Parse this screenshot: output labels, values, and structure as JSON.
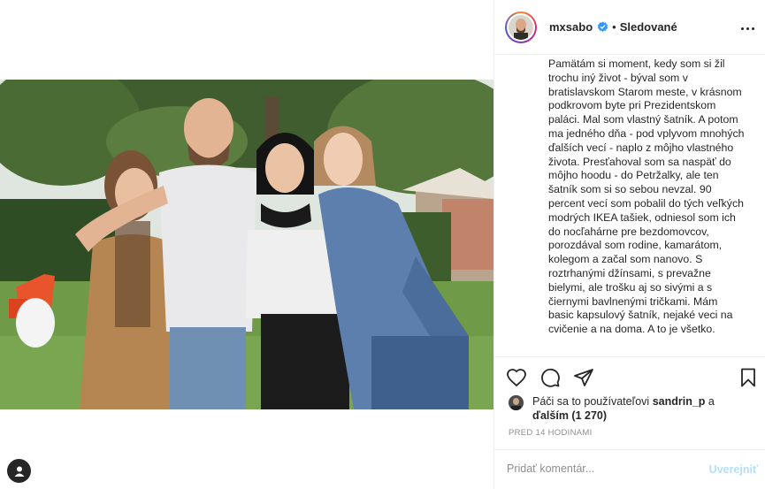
{
  "post": {
    "username": "mxsabo",
    "separator": "•",
    "follow_state": "Sledované",
    "caption": "Pamätám si moment, kedy som si žil trochu iný život - býval som v bratislavskom Starom meste, v krásnom podkrovom byte pri Prezidentskom paláci. Mal som vlastný šatník. A potom ma jedného dňa - pod vplyvom mnohých ďalších vecí - naplo z môjho vlastného života. Presťahoval som sa naspäť do môjho hoodu - do Petržalky, ale ten šatník som si so sebou nevzal. 90 percent vecí som pobalil do tých veľkých modrých IKEA tašiek, odniesol som ich do nocľahárne pre bezdomovcov, porozdával som rodine, kamarátom, kolegom a začal som nanovo. S roztrhanými džínsami, s prevažne bielymi, ale trošku aj so sivými a s čiernymi bavlnenými tričkami. Mám basic kapsulový šatník, nejaké veci na cvičenie a na doma. A to je všetko.",
    "likes_prefix": "Páči sa to používateľovi",
    "likes_user": "sandrin_p",
    "likes_and": "a",
    "likes_others": "ďalším (1 270)",
    "timestamp": "PRED 14 HODINAMI"
  },
  "comment": {
    "placeholder": "Pridať komentár...",
    "post_label": "Uverejniť"
  },
  "icons": {
    "verified": "verified-badge-icon",
    "more": "more-options-icon",
    "like": "heart-icon",
    "comment": "comment-icon",
    "share": "share-icon",
    "save": "bookmark-icon",
    "profile": "profile-icon"
  },
  "colors": {
    "verified": "#3897f0",
    "text": "#262626",
    "secondary": "#8e8e8e",
    "post_button_disabled": "#b2dffc",
    "border": "#efefef"
  }
}
